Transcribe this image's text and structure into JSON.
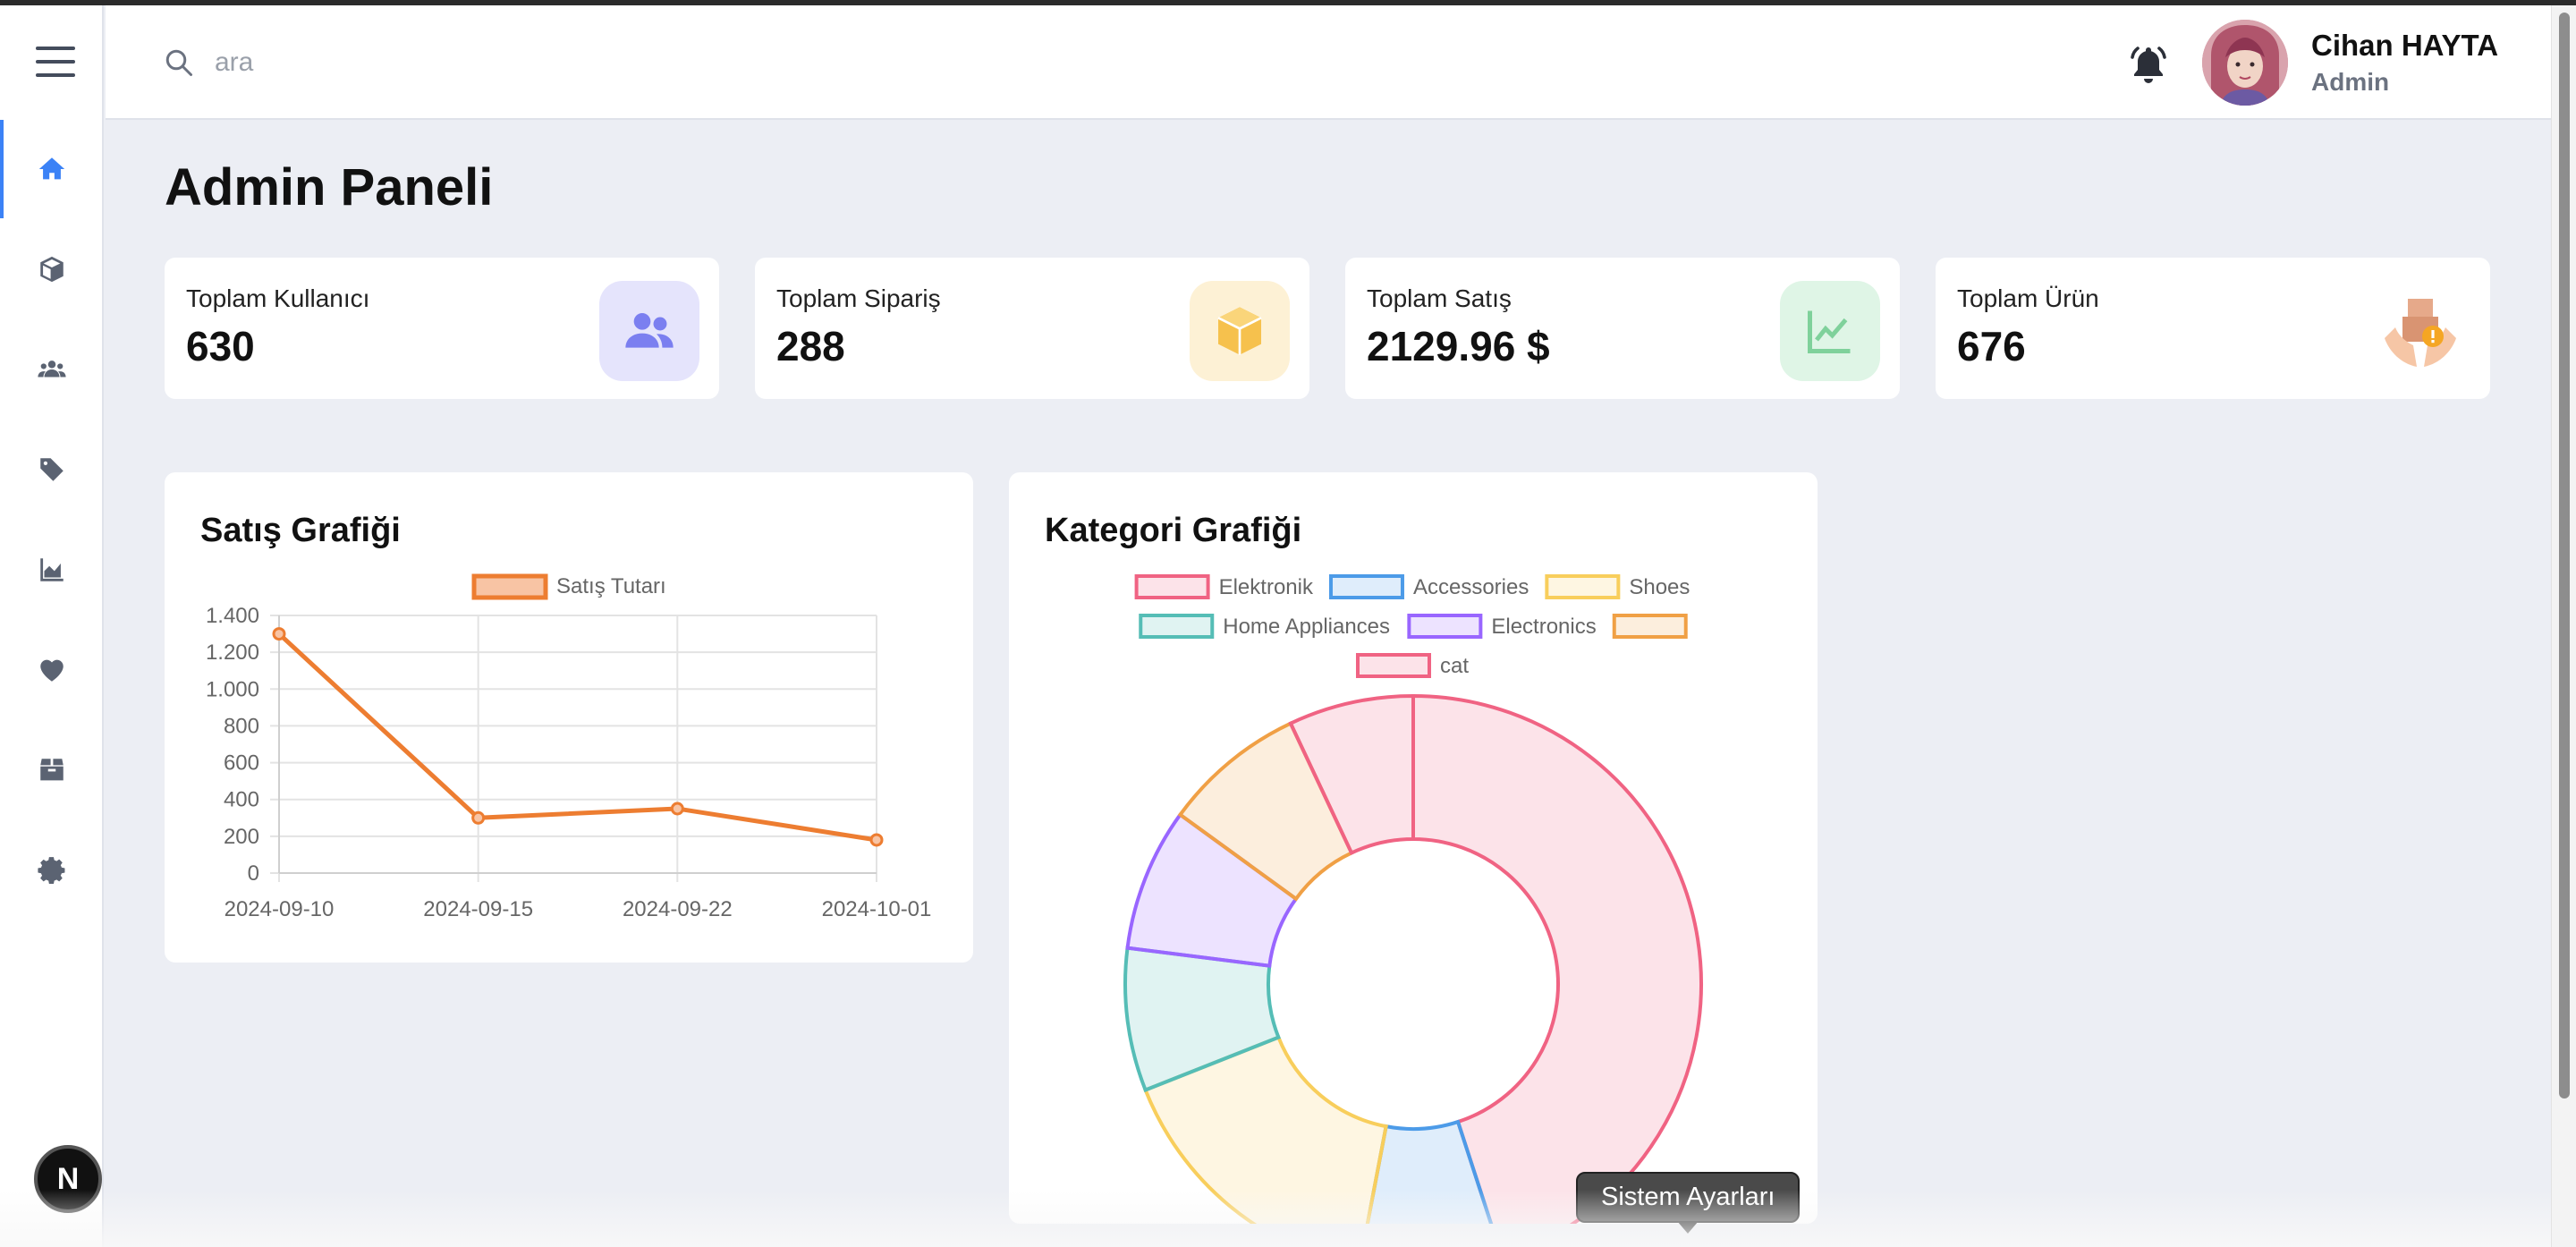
{
  "header": {
    "search_placeholder": "ara",
    "user_name": "Cihan HAYTA",
    "user_role": "Admin"
  },
  "sidebar": {
    "items": [
      {
        "icon": "home-icon",
        "active": true
      },
      {
        "icon": "cube-icon",
        "active": false
      },
      {
        "icon": "users-icon",
        "active": false
      },
      {
        "icon": "tag-icon",
        "active": false
      },
      {
        "icon": "area-chart-icon",
        "active": false
      },
      {
        "icon": "heart-icon",
        "active": false
      },
      {
        "icon": "box-icon",
        "active": false
      },
      {
        "icon": "gear-icon",
        "active": false
      }
    ],
    "badge": "N"
  },
  "main": {
    "title": "Admin Paneli",
    "stats": [
      {
        "label": "Toplam Kullanıcı",
        "value": "630",
        "icon": "users-icon",
        "color": "#7b7ff0"
      },
      {
        "label": "Toplam Sipariş",
        "value": "288",
        "icon": "box-icon",
        "color": "#f6c14d"
      },
      {
        "label": "Toplam Satış",
        "value": "2129.96 $",
        "icon": "line-chart-icon",
        "color": "#7fd19b"
      },
      {
        "label": "Toplam Ürün",
        "value": "676",
        "icon": "hands-package-icon",
        "color": "#f0a36b"
      }
    ]
  },
  "tooltip": "Sistem Ayarları",
  "chart_data": [
    {
      "type": "line",
      "title": "Satış Grafiği",
      "x": [
        "2024-09-10",
        "2024-09-15",
        "2024-09-22",
        "2024-10-01"
      ],
      "series": [
        {
          "name": "Satış Tutarı",
          "values": [
            1300,
            300,
            350,
            180
          ],
          "color": "#ed7d31"
        }
      ],
      "ylim": [
        0,
        1400
      ],
      "yticks": [
        "0",
        "200",
        "400",
        "600",
        "800",
        "1.000",
        "1.200",
        "1.400"
      ],
      "legend": "top",
      "grid": true
    },
    {
      "type": "pie",
      "donut": true,
      "title": "Kategori Grafiği",
      "labels": [
        "Elektronik",
        "Accessories",
        "Shoes",
        "Home Appliances",
        "Electronics",
        "",
        "cat"
      ],
      "values": [
        45,
        8,
        16,
        8,
        8,
        8,
        7
      ],
      "colors": [
        "#f06383",
        "#4c9be8",
        "#f8ce5c",
        "#55bdb6",
        "#9966ff",
        "#f0a045",
        "#f06383"
      ],
      "legend": "top"
    }
  ]
}
